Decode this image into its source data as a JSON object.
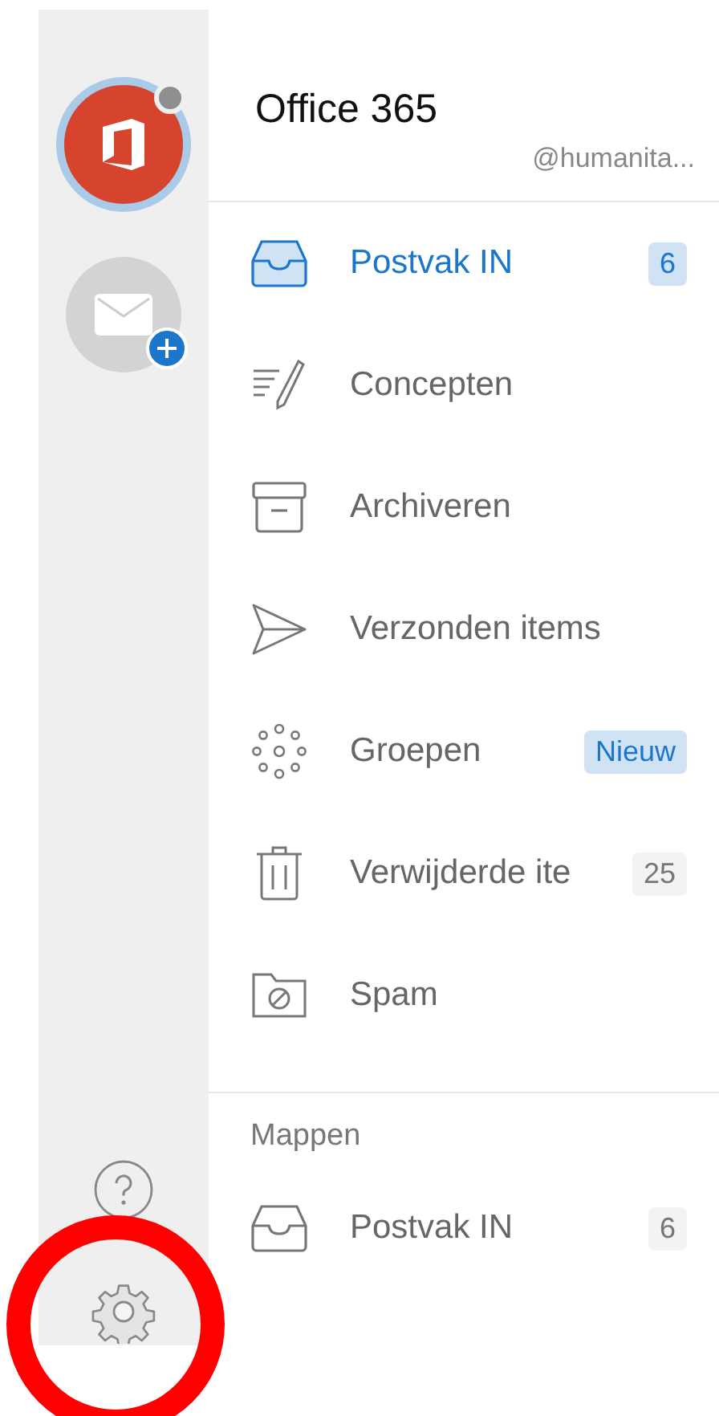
{
  "accounts": [
    {
      "kind": "office",
      "selected": true
    },
    {
      "kind": "add-mail",
      "selected": false
    }
  ],
  "rail_bottom": [
    {
      "kind": "help"
    },
    {
      "kind": "settings",
      "annotated": true
    }
  ],
  "account": {
    "title": "Office 365",
    "handle": "@humanita..."
  },
  "folders": [
    {
      "kind": "inbox",
      "label": "Postvak IN",
      "selected": true,
      "badge": {
        "text": "6",
        "kind": "count"
      }
    },
    {
      "kind": "drafts",
      "label": "Concepten",
      "selected": false
    },
    {
      "kind": "archive",
      "label": "Archiveren",
      "selected": false
    },
    {
      "kind": "sent",
      "label": "Verzonden items",
      "selected": false
    },
    {
      "kind": "groups",
      "label": "Groepen",
      "selected": false,
      "badge": {
        "text": "Nieuw",
        "kind": "new"
      }
    },
    {
      "kind": "trash",
      "label": "Verwijderde ite",
      "selected": false,
      "badge": {
        "text": "25",
        "kind": "count"
      }
    },
    {
      "kind": "spam",
      "label": "Spam",
      "selected": false
    }
  ],
  "section": {
    "title": "Mappen",
    "folders": [
      {
        "kind": "inbox",
        "label": "Postvak IN",
        "selected": false,
        "badge": {
          "text": "6",
          "kind": "count"
        }
      }
    ]
  }
}
